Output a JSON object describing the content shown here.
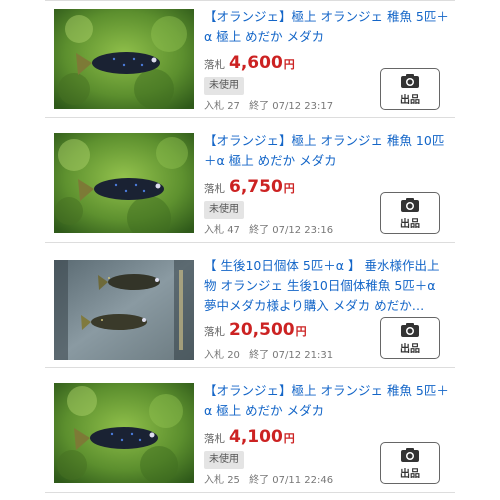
{
  "listings": [
    {
      "title": "【オランジェ】極上 オランジェ 稚魚 5匹＋α 極上 めだか メダカ",
      "price_label": "落札",
      "price": "4,600",
      "currency": "円",
      "condition": "未使用",
      "bids_label": "入札",
      "bids": "27",
      "end_label": "終了",
      "end_time": "07/12 23:17",
      "seller_button": "出品",
      "image_icon": "medaka-fish-photo"
    },
    {
      "title": "【オランジェ】極上 オランジェ 稚魚 10匹＋α 極上 めだか メダカ",
      "price_label": "落札",
      "price": "6,750",
      "currency": "円",
      "condition": "未使用",
      "bids_label": "入札",
      "bids": "47",
      "end_label": "終了",
      "end_time": "07/12 23:16",
      "seller_button": "出品",
      "image_icon": "medaka-fish-photo"
    },
    {
      "title": "【 生後10日個体 5匹＋α 】 垂水様作出上物 オランジェ 生後10日個体稚魚 5匹＋α 夢中メダカ様より購入 メダカ めだか…",
      "price_label": "落札",
      "price": "20,500",
      "currency": "円",
      "condition": "",
      "bids_label": "入札",
      "bids": "20",
      "end_label": "終了",
      "end_time": "07/12 21:31",
      "seller_button": "出品",
      "image_icon": "medaka-fish-tank-photo"
    },
    {
      "title": "【オランジェ】極上 オランジェ 稚魚 5匹＋α 極上 めだか メダカ",
      "price_label": "落札",
      "price": "4,100",
      "currency": "円",
      "condition": "未使用",
      "bids_label": "入札",
      "bids": "25",
      "end_label": "終了",
      "end_time": "07/11 22:46",
      "seller_button": "出品",
      "image_icon": "medaka-fish-photo"
    }
  ],
  "colors": {
    "title_link": "#1466c8",
    "price": "#cc2222",
    "badge_bg": "#e4e4e4",
    "divider": "#dddddd"
  }
}
